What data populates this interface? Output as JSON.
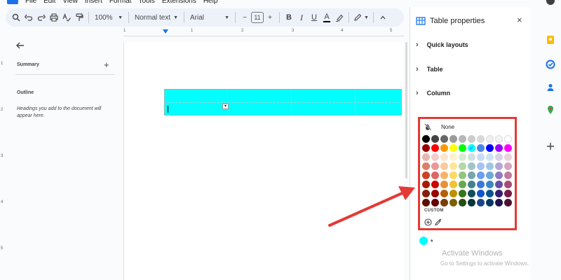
{
  "menubar": {
    "items": [
      "File",
      "Edit",
      "View",
      "Insert",
      "Format",
      "Tools",
      "Extensions",
      "Help"
    ]
  },
  "toolbar": {
    "zoom": "100%",
    "style": "Normal text",
    "font": "Arial",
    "font_size": "11",
    "minus": "−",
    "plus": "+",
    "bold": "B",
    "italic": "I",
    "underline": "U",
    "text_color": "A"
  },
  "ruler": {
    "labels": [
      "1",
      "1",
      "2",
      "3",
      "4",
      "5"
    ],
    "side_labels": [
      "1",
      "2",
      "3",
      "4",
      "5"
    ]
  },
  "outline_panel": {
    "summary": "Summary",
    "add": "+",
    "outline": "Outline",
    "hint": "Headings you add to the document will appear here."
  },
  "document": {
    "table_color": "#00ffff",
    "cell_menu": "▾"
  },
  "table_properties": {
    "title": "Table properties",
    "close": "×",
    "sections": [
      "Quick layouts",
      "Table",
      "Column"
    ]
  },
  "color_palette": {
    "none_label": "None",
    "custom_label": "CUSTOM",
    "selected": "#00ffff",
    "rows": [
      [
        "#000000",
        "#434343",
        "#666666",
        "#999999",
        "#b7b7b7",
        "#cccccc",
        "#d9d9d9",
        "#efefef",
        "#f3f3f3",
        "#ffffff"
      ],
      [
        "#980000",
        "#ff0000",
        "#ff9900",
        "#ffff00",
        "#00ff00",
        "#00ffff",
        "#4a86e8",
        "#0000ff",
        "#9900ff",
        "#ff00ff"
      ],
      [
        "#e6b8af",
        "#f4cccc",
        "#fce5cd",
        "#fff2cc",
        "#d9ead3",
        "#d0e0e3",
        "#c9daf8",
        "#cfe2f3",
        "#d9d2e9",
        "#ead1dc"
      ],
      [
        "#dd7e6b",
        "#ea9999",
        "#f9cb9c",
        "#ffe599",
        "#b6d7a8",
        "#a2c4c9",
        "#a4c2f4",
        "#9fc5e8",
        "#b4a7d6",
        "#d5a6bd"
      ],
      [
        "#cc4125",
        "#e06666",
        "#f6b26b",
        "#ffd966",
        "#93c47d",
        "#76a5af",
        "#6d9eeb",
        "#6fa8dc",
        "#8e7cc3",
        "#c27ba0"
      ],
      [
        "#a61c00",
        "#cc0000",
        "#e69138",
        "#f1c232",
        "#6aa84f",
        "#45818e",
        "#3c78d8",
        "#3d85c6",
        "#674ea7",
        "#a64d79"
      ],
      [
        "#85200c",
        "#990000",
        "#b45f06",
        "#bf9000",
        "#38761d",
        "#134f5c",
        "#1155cc",
        "#0b5394",
        "#351c75",
        "#741b47"
      ],
      [
        "#5b0f00",
        "#660000",
        "#783f04",
        "#7f6000",
        "#274e13",
        "#0c343d",
        "#1c4587",
        "#073763",
        "#20124d",
        "#4c1130"
      ]
    ]
  },
  "current_color": {
    "caret": "▴"
  },
  "watermark": {
    "title": "Activate Windows",
    "subtitle": "Go to Settings to activate Windows."
  },
  "annotation_color": "#e53935"
}
